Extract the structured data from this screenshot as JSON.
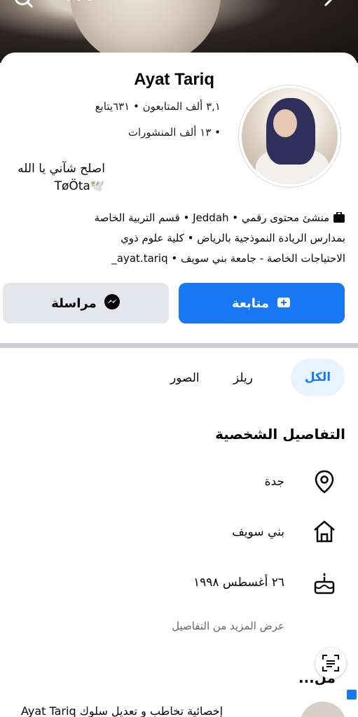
{
  "profile": {
    "name": "Ayat Tariq",
    "stats_line1": "٣,١ ألف المتابعون • ٦٣١يتابع",
    "stats_line2": "• ١٣ ألف المنشورات",
    "bio_line1": "اصلح شآني يا الله",
    "bio_line2": "TøÖta🕊️"
  },
  "info": {
    "line1": "منشئ محتوى رقمي • Jeddah • قسم التربية الخاصة",
    "line2": "بمدارس الريادة النموذجية بالرياض • كلية علوم ذوي",
    "line3": "الاحتياجات الخاصة - جامعة بني سويف • ayat.tariq_"
  },
  "buttons": {
    "follow": "متابعة",
    "message": "مراسلة"
  },
  "tabs": {
    "all": "الكل",
    "reels": "ريلز",
    "photos": "الصور"
  },
  "details": {
    "title": "التفاصيل الشخصية",
    "location": "جدة",
    "hometown": "بني سويف",
    "birthday": "٢٦ أغسطس ١٩٩٨",
    "see_more": "عرض المزيد من التفاصيل"
  },
  "featured": {
    "partial_title": "...مل",
    "post_text": "Ayat Tariq إخصائية تخاطب و تعديل سلوك"
  },
  "colors": {
    "accent": "#1877f2",
    "tab_bg": "#e7f3ff",
    "secondary_btn": "#e4e6eb"
  }
}
